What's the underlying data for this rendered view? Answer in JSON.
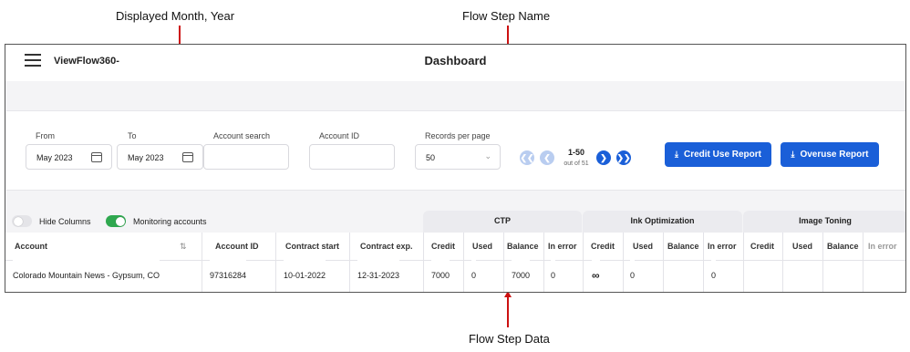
{
  "annotations": {
    "month_year": "Displayed Month, Year",
    "flow_step_name": "Flow Step Name",
    "flow_step_data": "Flow Step Data"
  },
  "app": {
    "brand": "ViewFlow360-",
    "title": "Dashboard"
  },
  "filters": {
    "from_label": "From",
    "from_value": "May 2023",
    "to_label": "To",
    "to_value": "May 2023",
    "account_search_label": "Account search",
    "account_search_value": "",
    "account_id_label": "Account ID",
    "account_id_value": "",
    "records_label": "Records per page",
    "records_value": "50"
  },
  "pagination": {
    "range": "1-50",
    "total": "out of 51"
  },
  "buttons": {
    "credit_use": "Credit Use Report",
    "overuse": "Overuse Report"
  },
  "toggles": {
    "hide_columns": {
      "label": "Hide Columns",
      "on": false
    },
    "monitoring": {
      "label": "Monitoring accounts",
      "on": true
    }
  },
  "groups": {
    "ctp": "CTP",
    "ink": "Ink Optimization",
    "toning": "Image Toning"
  },
  "columns": {
    "account": "Account",
    "account_id": "Account ID",
    "contract_start": "Contract start",
    "contract_exp": "Contract exp.",
    "credit": "Credit",
    "used": "Used",
    "balance": "Balance",
    "in_error": "In error"
  },
  "row": {
    "account": "Colorado Mountain News - Gypsum, CO",
    "account_id": "97316284",
    "contract_start": "10-01-2022",
    "contract_exp": "12-31-2023",
    "ctp": {
      "credit": "7000",
      "used": "0",
      "balance": "7000",
      "in_error": "0"
    },
    "ink": {
      "credit": "∞",
      "used": "0",
      "balance": "",
      "in_error": "0"
    },
    "toning": {
      "credit": "",
      "used": "",
      "balance": "",
      "in_error": ""
    }
  },
  "colors": {
    "accent": "#1a5fd8",
    "annotation": "#cc1111",
    "toggle_on": "#2fa84f"
  }
}
